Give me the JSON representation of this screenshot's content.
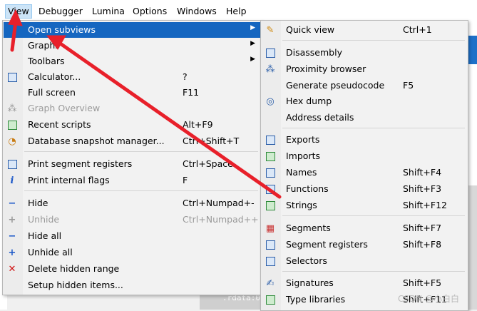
{
  "menubar": {
    "items": [
      "View",
      "Debugger",
      "Lumina",
      "Options",
      "Windows",
      "Help"
    ]
  },
  "view_menu": {
    "items": [
      {
        "label": "Open subviews",
        "shortcut": "",
        "submenu": true,
        "highlighted": true,
        "icon": "none"
      },
      {
        "label": "Graphs",
        "shortcut": "",
        "submenu": true,
        "icon": "none"
      },
      {
        "label": "Toolbars",
        "shortcut": "",
        "submenu": true,
        "icon": "none"
      },
      {
        "label": "Calculator...",
        "shortcut": "?",
        "icon": "calculator-icon"
      },
      {
        "label": "Full screen",
        "shortcut": "F11",
        "icon": "none"
      },
      {
        "label": "Graph Overview",
        "shortcut": "",
        "disabled": true,
        "icon": "graph-overview-icon"
      },
      {
        "label": "Recent scripts",
        "shortcut": "Alt+F9",
        "icon": "recent-scripts-icon"
      },
      {
        "label": "Database snapshot manager...",
        "shortcut": "Ctrl+Shift+T",
        "icon": "snapshot-icon"
      },
      {
        "label": "Print segment registers",
        "shortcut": "Ctrl+Space",
        "icon": "registers-icon"
      },
      {
        "label": "Print internal flags",
        "shortcut": "F",
        "icon": "info-icon"
      },
      {
        "label": "Hide",
        "shortcut": "Ctrl+Numpad+-",
        "icon": "hide-icon"
      },
      {
        "label": "Unhide",
        "shortcut": "Ctrl+Numpad++",
        "disabled": true,
        "icon": "unhide-icon"
      },
      {
        "label": "Hide all",
        "shortcut": "",
        "icon": "hide-all-icon"
      },
      {
        "label": "Unhide all",
        "shortcut": "",
        "icon": "unhide-all-icon"
      },
      {
        "label": "Delete hidden range",
        "shortcut": "",
        "icon": "delete-icon"
      },
      {
        "label": "Setup hidden items...",
        "shortcut": "",
        "icon": "none"
      }
    ]
  },
  "subviews_menu": {
    "items": [
      {
        "label": "Quick view",
        "shortcut": "Ctrl+1",
        "icon": "quick-view-icon"
      },
      {
        "label": "Disassembly",
        "shortcut": "",
        "icon": "disassembly-icon"
      },
      {
        "label": "Proximity browser",
        "shortcut": "",
        "icon": "proximity-icon"
      },
      {
        "label": "Generate pseudocode",
        "shortcut": "F5",
        "icon": "none"
      },
      {
        "label": "Hex dump",
        "shortcut": "",
        "icon": "hex-dump-icon"
      },
      {
        "label": "Address details",
        "shortcut": "",
        "icon": "none"
      },
      {
        "label": "Exports",
        "shortcut": "",
        "icon": "exports-icon"
      },
      {
        "label": "Imports",
        "shortcut": "",
        "icon": "imports-icon"
      },
      {
        "label": "Names",
        "shortcut": "Shift+F4",
        "icon": "names-icon"
      },
      {
        "label": "Functions",
        "shortcut": "Shift+F3",
        "icon": "functions-icon"
      },
      {
        "label": "Strings",
        "shortcut": "Shift+F12",
        "icon": "strings-icon"
      },
      {
        "label": "Segments",
        "shortcut": "Shift+F7",
        "icon": "segments-icon"
      },
      {
        "label": "Segment registers",
        "shortcut": "Shift+F8",
        "icon": "segment-registers-icon"
      },
      {
        "label": "Selectors",
        "shortcut": "",
        "icon": "selectors-icon"
      },
      {
        "label": "Signatures",
        "shortcut": "Shift+F5",
        "icon": "signatures-icon"
      },
      {
        "label": "Type libraries",
        "shortcut": "Shift+F11",
        "icon": "type-libraries-icon"
      }
    ]
  },
  "background": {
    "code_text": ".rdata:0"
  },
  "watermark": "CSDN @小白白",
  "colors": {
    "highlight": "#1566c0",
    "annotation_arrow": "#e8202a"
  }
}
